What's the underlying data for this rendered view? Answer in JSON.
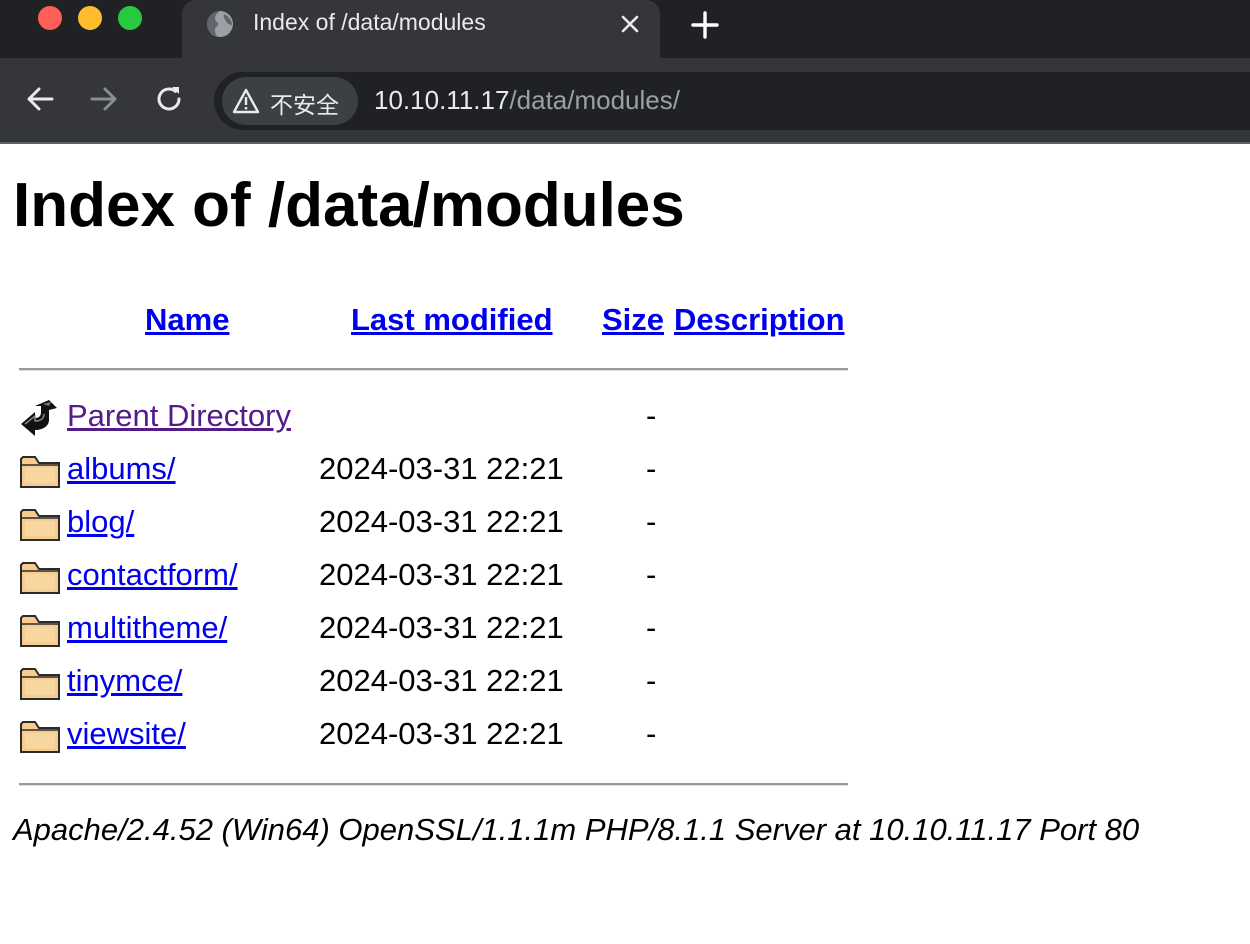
{
  "browser": {
    "tab": {
      "title": "Index of /data/modules",
      "icon": "globe-icon"
    },
    "security_label": "不安全",
    "url_host": "10.10.11.17",
    "url_path": "/data/modules/"
  },
  "page": {
    "heading": "Index of /data/modules",
    "columns": {
      "name": "Name",
      "last_modified": "Last modified",
      "size": "Size",
      "description": "Description"
    },
    "parent": {
      "name": "Parent Directory",
      "size": "-",
      "icon": "back-arrow-icon"
    },
    "entries": [
      {
        "name": "albums/",
        "modified": "2024-03-31 22:21",
        "size": "-",
        "icon": "folder-icon"
      },
      {
        "name": "blog/",
        "modified": "2024-03-31 22:21",
        "size": "-",
        "icon": "folder-icon"
      },
      {
        "name": "contactform/",
        "modified": "2024-03-31 22:21",
        "size": "-",
        "icon": "folder-icon"
      },
      {
        "name": "multitheme/",
        "modified": "2024-03-31 22:21",
        "size": "-",
        "icon": "folder-icon"
      },
      {
        "name": "tinymce/",
        "modified": "2024-03-31 22:21",
        "size": "-",
        "icon": "folder-icon"
      },
      {
        "name": "viewsite/",
        "modified": "2024-03-31 22:21",
        "size": "-",
        "icon": "folder-icon"
      }
    ],
    "server_signature": "Apache/2.4.52 (Win64) OpenSSL/1.1.1m PHP/8.1.1 Server at 10.10.11.17 Port 80"
  },
  "colors": {
    "link": "#0000ee",
    "visited_link": "#551a8b",
    "chrome_dark": "#202124",
    "chrome_tab": "#35363a"
  }
}
